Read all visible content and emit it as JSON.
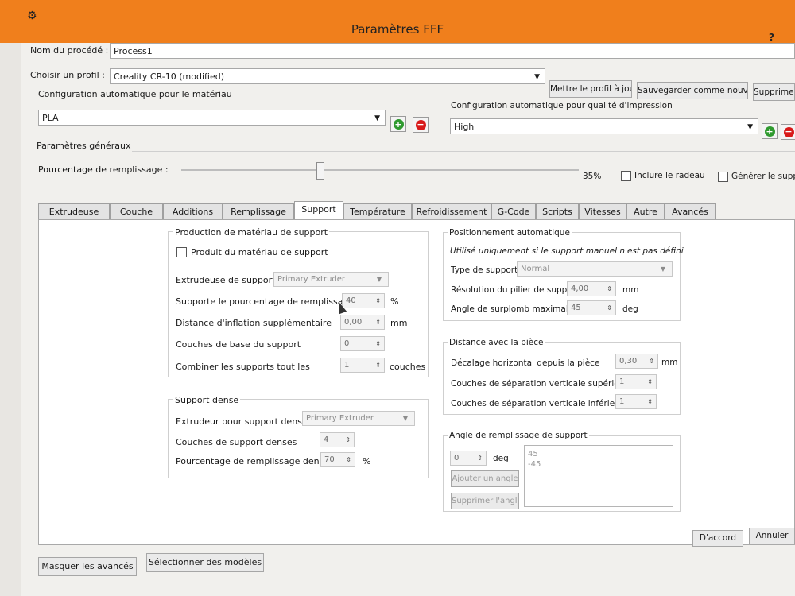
{
  "window": {
    "title": "Paramètres FFF",
    "help": "?"
  },
  "process": {
    "label": "Nom du procédé :",
    "value": "Process1"
  },
  "profile": {
    "label": "Choisir un profil :",
    "value": "Creality CR-10 (modified)",
    "update_btn": "Mettre le profil à jour",
    "save_new_btn": "Sauvegarder comme nouveau",
    "delete_btn": "Supprimer"
  },
  "material": {
    "label": "Configuration automatique pour le matériau",
    "value": "PLA"
  },
  "quality": {
    "label": "Configuration automatique pour qualité d'impression",
    "value": "High"
  },
  "general": {
    "label": "Paramètres généraux",
    "infill_label": "Pourcentage de remplissage :",
    "infill_value": "35%",
    "infill_fraction": 0.35,
    "raft_label": "Inclure le radeau",
    "support_label": "Générer le support"
  },
  "tabs": [
    {
      "label": "Extrudeuse"
    },
    {
      "label": "Couche"
    },
    {
      "label": "Additions"
    },
    {
      "label": "Remplissage"
    },
    {
      "label": "Support"
    },
    {
      "label": "Température"
    },
    {
      "label": "Refroidissement"
    },
    {
      "label": "G-Code"
    },
    {
      "label": "Scripts"
    },
    {
      "label": "Vitesses"
    },
    {
      "label": "Autre"
    },
    {
      "label": "Avancés"
    }
  ],
  "support_production": {
    "title": "Production de matériau de support",
    "checkbox_label": "Produit du matériau de support",
    "extruder_label": "Extrudeuse de support",
    "extruder_value": "Primary Extruder",
    "infill_pct_label": "Supporte le pourcentage de remplissage",
    "infill_pct_value": "40",
    "infill_pct_unit": "%",
    "inflation_label": "Distance d'inflation supplémentaire",
    "inflation_value": "0,00",
    "inflation_unit": "mm",
    "base_layers_label": "Couches de base du support",
    "base_layers_value": "0",
    "combine_label": "Combiner les supports tout les",
    "combine_value": "1",
    "combine_unit": "couches"
  },
  "dense_support": {
    "title": "Support dense",
    "extruder_label": "Extrudeur pour support dense",
    "extruder_value": "Primary Extruder",
    "layers_label": "Couches de support denses",
    "layers_value": "4",
    "infill_label": "Pourcentage de remplissage dense",
    "infill_value": "70",
    "infill_unit": "%"
  },
  "auto_position": {
    "title": "Positionnement automatique",
    "note": "Utilisé uniquement si le support manuel n'est pas défini",
    "type_label": "Type de support",
    "type_value": "Normal",
    "pillar_label": "Résolution du pilier de support",
    "pillar_value": "4,00",
    "pillar_unit": "mm",
    "overhang_label": "Angle de surplomb maximal",
    "overhang_value": "45",
    "overhang_unit": "deg"
  },
  "part_distance": {
    "title": "Distance avec la pièce",
    "horizontal_label": "Décalage horizontal depuis la pièce",
    "horizontal_value": "0,30",
    "horizontal_unit": "mm",
    "upper_label": "Couches de séparation verticale supérieure",
    "upper_value": "1",
    "lower_label": "Couches de séparation verticale inférieure",
    "lower_value": "1"
  },
  "infill_angles": {
    "title": "Angle de remplissage de support",
    "angle_value": "0",
    "angle_unit": "deg",
    "add_btn": "Ajouter un angle",
    "remove_btn": "Supprimer l'angle",
    "list": [
      "45",
      "-45"
    ]
  },
  "footer": {
    "hide_advanced_btn": "Masquer les avancés",
    "select_models_btn": "Sélectionner des modèles",
    "ok_btn": "D'accord",
    "cancel_btn": "Annuler"
  },
  "colors": {
    "titlebar": "#f07f1c",
    "add": "#2f9a2f",
    "remove": "#d81919"
  }
}
